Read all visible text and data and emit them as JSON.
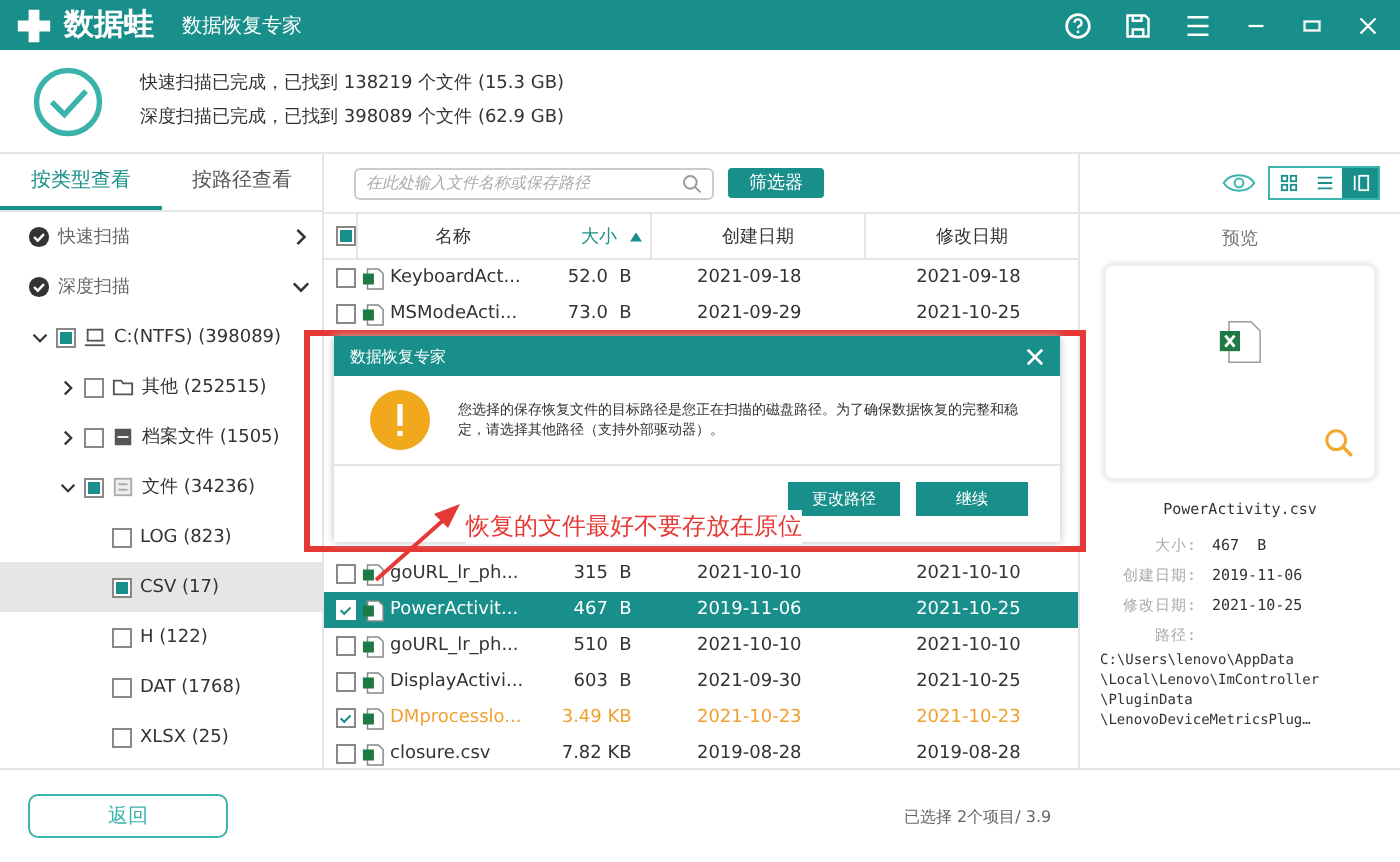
{
  "title_bar": {
    "logo": "数据蛙",
    "subtitle": "数据恢复专家"
  },
  "scan_summary": [
    "快速扫描已完成，已找到 138219 个文件 (15.3 GB)",
    "深度扫描已完成，已找到 398089 个文件 (62.9 GB)"
  ],
  "view_tabs": [
    {
      "label": "按类型查看",
      "selected": true
    },
    {
      "label": "按路径查看",
      "selected": false
    }
  ],
  "tree": [
    {
      "kind": "scan",
      "label": "快速扫描",
      "expanded": false,
      "selected": false
    },
    {
      "kind": "scan",
      "label": "深度扫描",
      "expanded": true,
      "selected": false,
      "children": [
        {
          "kind": "drive",
          "label": "C:(NTFS) (398089)",
          "expanded": true,
          "checked": false,
          "partial": true,
          "selected": false,
          "children": [
            {
              "kind": "folder",
              "label": "其他 (252515)",
              "expanded": false,
              "checked": false,
              "partial": false,
              "selected": false
            },
            {
              "kind": "archive",
              "label": "档案文件 (1505)",
              "expanded": false,
              "checked": false,
              "partial": false,
              "selected": false
            },
            {
              "kind": "document",
              "label": "文件 (34236)",
              "expanded": true,
              "checked": false,
              "partial": true,
              "selected": false,
              "children": [
                {
                  "kind": "type",
                  "label": "LOG (823)",
                  "checked": false,
                  "partial": false,
                  "selected": false
                },
                {
                  "kind": "type",
                  "label": "CSV (17)",
                  "checked": false,
                  "partial": true,
                  "selected": true
                },
                {
                  "kind": "type",
                  "label": "H (122)",
                  "checked": false,
                  "partial": false,
                  "selected": false
                },
                {
                  "kind": "type",
                  "label": "DAT (1768)",
                  "checked": false,
                  "partial": false,
                  "selected": false
                },
                {
                  "kind": "type",
                  "label": "XLSX (25)",
                  "checked": false,
                  "partial": false,
                  "selected": false
                }
              ]
            }
          ]
        }
      ]
    }
  ],
  "search": {
    "placeholder": "在此处输入文件名称或保存路径"
  },
  "filter_button": "筛选器",
  "view_modes": [
    {
      "kind": "grid",
      "selected": false
    },
    {
      "kind": "list",
      "selected": false
    },
    {
      "kind": "detail",
      "selected": true
    }
  ],
  "table": {
    "header_checkbox": {
      "checked": false,
      "partial": true
    },
    "columns": [
      {
        "label": "名称",
        "sorted": false
      },
      {
        "label": "大小",
        "sorted": true
      },
      {
        "label": "创建日期",
        "sorted": false
      },
      {
        "label": "修改日期",
        "sorted": false
      }
    ],
    "rows_top": [
      {
        "name": "KeyboardAct...",
        "size": "52.0  B",
        "created": "2021-09-18",
        "modified": "2021-09-18",
        "checked": false,
        "selected": false,
        "flagged": false
      },
      {
        "name": "MSModeActi...",
        "size": "73.0  B",
        "created": "2021-09-29",
        "modified": "2021-10-25",
        "checked": false,
        "selected": false,
        "flagged": false
      }
    ],
    "rows_bottom": [
      {
        "name": "goURL_lr_ph...",
        "size": "315  B",
        "created": "2021-10-10",
        "modified": "2021-10-10",
        "checked": false,
        "selected": false,
        "flagged": false
      },
      {
        "name": "PowerActivit...",
        "size": "467  B",
        "created": "2019-11-06",
        "modified": "2021-10-25",
        "checked": true,
        "selected": true,
        "flagged": false
      },
      {
        "name": "goURL_lr_ph...",
        "size": "510  B",
        "created": "2021-10-10",
        "modified": "2021-10-10",
        "checked": false,
        "selected": false,
        "flagged": false
      },
      {
        "name": "DisplayActivi...",
        "size": "603  B",
        "created": "2021-09-30",
        "modified": "2021-10-25",
        "checked": false,
        "selected": false,
        "flagged": false
      },
      {
        "name": "DMprocesslo...",
        "size": "3.49 KB",
        "created": "2021-10-23",
        "modified": "2021-10-23",
        "checked": true,
        "selected": false,
        "flagged": true
      },
      {
        "name": "closure.csv",
        "size": "7.82 KB",
        "created": "2019-08-28",
        "modified": "2019-08-28",
        "checked": false,
        "selected": false,
        "flagged": false
      }
    ]
  },
  "preview": {
    "title": "预览",
    "filename": "PowerActivity.csv",
    "details": [
      {
        "label": "大小:",
        "value": "467  B"
      },
      {
        "label": "创建日期:",
        "value": "2019-11-06"
      },
      {
        "label": "修改日期:",
        "value": "2021-10-25"
      }
    ],
    "path_label": "路径:",
    "path_lines": [
      "C:\\Users\\lenovo\\AppData",
      "\\Local\\Lenovo\\ImController",
      "\\PluginData",
      "\\LenovoDeviceMetricsPlug…"
    ]
  },
  "back_button": "返回",
  "status": "已选择 2个项目/ 3.9",
  "dialog": {
    "title": "数据恢复专家",
    "message": "您选择的保存恢复文件的目标路径是您正在扫描的磁盘路径。为了确保数据恢复的完整和稳定，请选择其他路径（支持外部驱动器）。",
    "buttons": [
      "更改路径",
      "继续"
    ]
  },
  "annotation": {
    "text": "恢复的文件最好不要存放在原位"
  }
}
